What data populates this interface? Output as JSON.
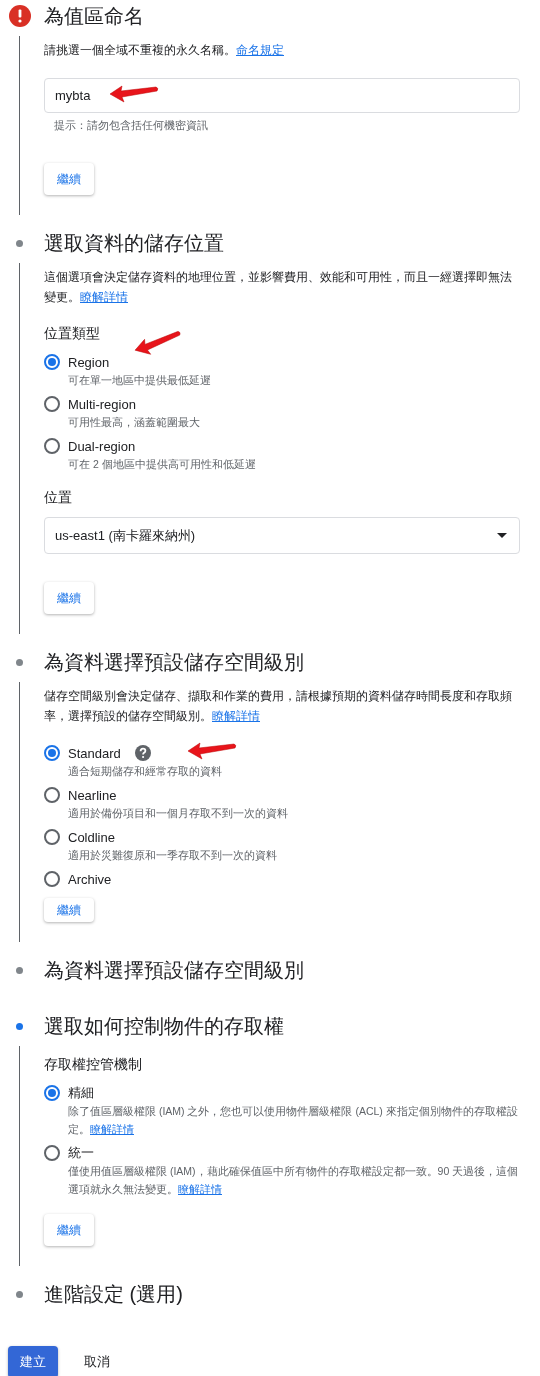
{
  "steps": [
    {
      "title": "為值區命名",
      "kind": "error",
      "body": [
        {
          "kind": "paragraph",
          "text": "請挑選一個全域不重複的永久名稱。",
          "link": "命名規定"
        },
        {
          "kind": "field",
          "value": "mybta",
          "hint": "提示：請勿包含括任何機密資訊",
          "arrow": true
        },
        {
          "kind": "button",
          "label": "繼續",
          "overlapping": false
        }
      ]
    },
    {
      "title": "選取資料的儲存位置",
      "kind": "pending",
      "body": [
        {
          "kind": "paragraph",
          "text": "這個選項會決定儲存資料的地理位置，並影響費用、效能和可用性，而且一經選擇即無法變更。",
          "link": "瞭解詳情"
        },
        {
          "kind": "label",
          "text": "位置類型",
          "arrow": true
        },
        {
          "kind": "radio_group",
          "options": [
            {
              "label": "Region",
              "description": "可在單一地區中提供最低延遲",
              "selected": true
            },
            {
              "label": "Multi-region",
              "description": "可用性最高，涵蓋範圍最大",
              "selected": false
            },
            {
              "label": "Dual-region",
              "description": "可在 2 個地區中提供高可用性和低延遲",
              "selected": false
            }
          ]
        },
        {
          "kind": "label",
          "text": "位置",
          "arrow": false
        },
        {
          "kind": "select",
          "value": "us-east1 (南卡羅來納州)"
        },
        {
          "kind": "button",
          "label": "繼續",
          "overlapping": false
        }
      ]
    },
    {
      "title": "為資料選擇預設儲存空間級別",
      "kind": "pending",
      "body": [
        {
          "kind": "paragraph",
          "text": "儲存空間級別會決定儲存、擷取和作業的費用，請根據預期的資料儲存時間長度和存取頻率，選擇預設的儲存空間級別。",
          "link": "瞭解詳情"
        },
        {
          "kind": "radio_group",
          "options": [
            {
              "label": "Standard",
              "description": "適合短期儲存和經常存取的資料",
              "selected": true,
              "help": true,
              "arrow": true
            },
            {
              "label": "Nearline",
              "description": "適用於備份項目和一個月存取不到一次的資料",
              "selected": false
            },
            {
              "label": "Coldline",
              "description": "適用於災難復原和一季存取不到一次的資料",
              "selected": false
            },
            {
              "label": "Archive",
              "selected": false
            }
          ]
        },
        {
          "kind": "button",
          "label": "繼續",
          "overlapping": true
        }
      ]
    },
    {
      "title": "為資料選擇預設儲存空間級別",
      "kind": "pending"
    },
    {
      "title": "選取如何控制物件的存取權",
      "kind": "active",
      "body": [
        {
          "kind": "label",
          "text": "存取權控管機制",
          "arrow": false
        },
        {
          "kind": "radio_group",
          "options": [
            {
              "label": "精細",
              "description": "除了值區層級權限 (IAM) 之外，您也可以使用物件層級權限 (ACL) 來指定個別物件的存取權設定。",
              "link": "瞭解詳情",
              "selected": true
            },
            {
              "label": "統一",
              "description": "僅使用值區層級權限 (IAM)，藉此確保值區中所有物件的存取權設定都一致。90 天過後，這個選項就永久無法變更。",
              "link": "瞭解詳情",
              "selected": false
            }
          ]
        },
        {
          "kind": "button",
          "label": "繼續",
          "overlapping": false
        }
      ]
    },
    {
      "title": "進階設定 (選用)",
      "kind": "pending"
    }
  ],
  "actions": [
    {
      "label": "建立",
      "kind": "primary"
    },
    {
      "label": "取消",
      "kind": "text"
    }
  ]
}
